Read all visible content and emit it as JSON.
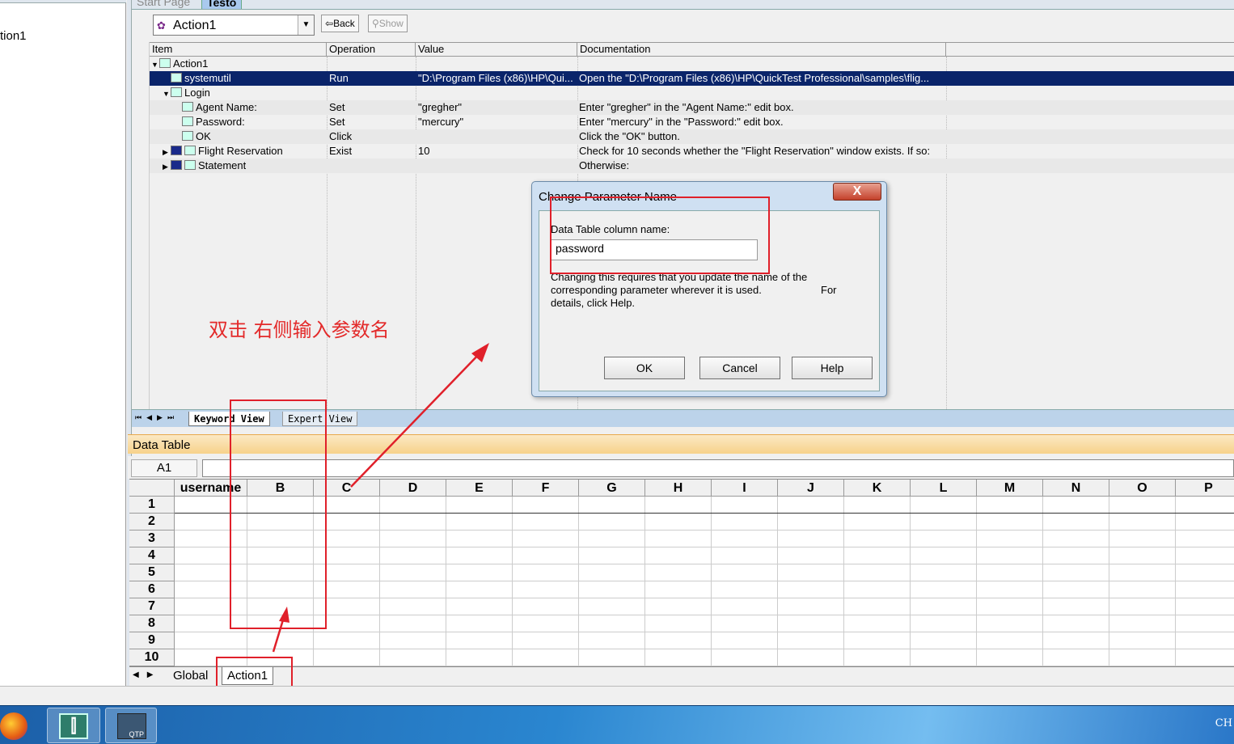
{
  "left_pane": {
    "node_label": "tion1"
  },
  "doc_tabs": {
    "start_page": "Start Page",
    "test": "Testo"
  },
  "toolbar": {
    "action_combo": "Action1",
    "back": "Back",
    "show": "Show"
  },
  "keyword_view": {
    "columns": [
      "Item",
      "Operation",
      "Value",
      "Documentation"
    ],
    "rows": [
      {
        "item": "Action1",
        "operation": "",
        "value": "",
        "doc": "",
        "indent": 0,
        "icon": "action-icon",
        "expander": "▼"
      },
      {
        "item": "systemutil",
        "operation": "Run",
        "value": "\"D:\\Program Files (x86)\\HP\\Qui...",
        "doc": "Open the \"D:\\Program Files (x86)\\HP\\QuickTest Professional\\samples\\flig...",
        "indent": 1,
        "icon": "systemutil-icon",
        "expander": "",
        "selected": true
      },
      {
        "item": "Login",
        "operation": "",
        "value": "",
        "doc": "",
        "indent": 1,
        "icon": "dialog-icon",
        "expander": "▼"
      },
      {
        "item": "Agent Name:",
        "operation": "Set",
        "value": "\"gregher\"",
        "doc": "Enter \"gregher\" in the \"Agent Name:\" edit box.",
        "indent": 2,
        "icon": "editbox-icon",
        "expander": ""
      },
      {
        "item": "Password:",
        "operation": "Set",
        "value": "\"mercury\"",
        "doc": "Enter \"mercury\" in the \"Password:\" edit box.",
        "indent": 2,
        "icon": "editbox-icon",
        "expander": ""
      },
      {
        "item": "OK",
        "operation": "Click",
        "value": "",
        "doc": "Click the \"OK\" button.",
        "indent": 2,
        "icon": "button-icon",
        "expander": ""
      },
      {
        "item": "Flight Reservation",
        "operation": "Exist",
        "value": "10",
        "doc": "Check for 10 seconds whether the \"Flight Reservation\" window exists. If so:",
        "indent": 1,
        "icon": "window-icon",
        "expander": "▶",
        "badge": "IF"
      },
      {
        "item": "Statement",
        "operation": "",
        "value": "",
        "doc": "Otherwise:",
        "indent": 1,
        "icon": "statement-icon",
        "expander": "▶",
        "badge": "ELSE"
      }
    ]
  },
  "view_tabs": {
    "keyword": "Keyword View",
    "expert": "Expert View"
  },
  "data_table": {
    "title": "Data Table",
    "cell_ref": "A1",
    "columns": [
      "username",
      "B",
      "C",
      "D",
      "E",
      "F",
      "G",
      "H",
      "I",
      "J",
      "K",
      "L",
      "M",
      "N",
      "O",
      "P"
    ],
    "rows": [
      "1",
      "2",
      "3",
      "4",
      "5",
      "6",
      "7",
      "8",
      "9",
      "10"
    ],
    "sheets": [
      "Global",
      "Action1"
    ]
  },
  "dialog": {
    "title": "Change Parameter Name",
    "close": "X",
    "label": "Data Table column name:",
    "value": "password",
    "help_line1": "Changing this requires that you update the name of the",
    "help_line2": "corresponding parameter wherever it is used.",
    "help_for": "For",
    "help_line3": "details, click Help.",
    "ok": "OK",
    "cancel": "Cancel",
    "help": "Help"
  },
  "annotation": {
    "text": "双击 右侧输入参数名",
    "color": "#e32a2a"
  },
  "taskbar": {
    "lang": "CH"
  },
  "colors": {
    "selection": "#0a246a",
    "annotation": "#e0202a",
    "datatable_header": "#f7d28a"
  }
}
